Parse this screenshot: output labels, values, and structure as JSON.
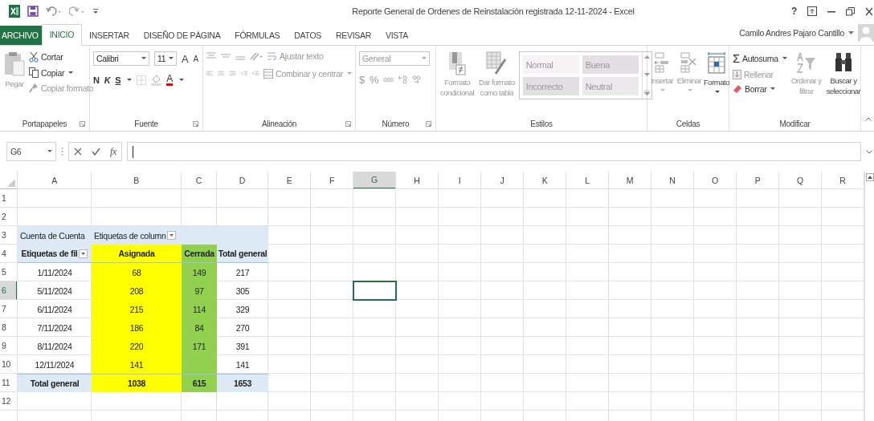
{
  "title_bar": {
    "title": "Reporte General de Ordenes de Reinstalación registrada 12-11-2024 - Excel",
    "help": "?"
  },
  "tabs": [
    {
      "label": "ARCHIVO",
      "kind": "file",
      "selected": false
    },
    {
      "label": "INICIO",
      "kind": "tab",
      "selected": true
    },
    {
      "label": "INSERTAR",
      "kind": "tab",
      "selected": false
    },
    {
      "label": "DISEÑO DE PÁGINA",
      "kind": "tab",
      "selected": false
    },
    {
      "label": "FÓRMULAS",
      "kind": "tab",
      "selected": false
    },
    {
      "label": "DATOS",
      "kind": "tab",
      "selected": false
    },
    {
      "label": "REVISAR",
      "kind": "tab",
      "selected": false
    },
    {
      "label": "VISTA",
      "kind": "tab",
      "selected": false
    }
  ],
  "account": {
    "user": "Camilo Andres Pajaro Cantillo"
  },
  "ribbon": {
    "clipboard": {
      "label": "Portapapeles",
      "paste": {
        "label": "Pegar",
        "disabled": true
      },
      "cut": {
        "label": "Cortar",
        "disabled": false
      },
      "copy": {
        "label": "Copiar",
        "disabled": false
      },
      "format_painter": {
        "label": "Copiar formato",
        "disabled": true
      }
    },
    "font": {
      "label": "Fuente",
      "font_name": "Calibri",
      "font_size": "11",
      "grow": "A",
      "shrink": "A",
      "bold": "N",
      "italic": "K",
      "underline": "S",
      "font_color": "A"
    },
    "alignment": {
      "label": "Alineación",
      "wrap_text": {
        "label": "Ajustar texto",
        "disabled": true
      },
      "merge": {
        "label": "Combinar y centrar",
        "disabled": true
      }
    },
    "number": {
      "label": "Número",
      "format": "General",
      "currency": "$",
      "percent": "%",
      "thousands": "000"
    },
    "styles": {
      "label": "Estilos",
      "conditional": {
        "lines": [
          "Formato",
          "condicional"
        ],
        "disabled": true
      },
      "as_table": {
        "lines": [
          "Dar formato",
          "como tabla"
        ],
        "disabled": true
      },
      "cell_styles": [
        {
          "label": "Normal",
          "kind": "normal"
        },
        {
          "label": "Buena",
          "kind": "good"
        },
        {
          "label": "Incorrecto",
          "kind": "bad"
        },
        {
          "label": "Neutral",
          "kind": "neutral"
        }
      ]
    },
    "cells": {
      "label": "Celdas",
      "items": [
        {
          "label": "Insertar",
          "disabled": true
        },
        {
          "label": "Eliminar",
          "disabled": true
        },
        {
          "label": "Formato",
          "disabled": false
        }
      ]
    },
    "editing": {
      "label": "Modificar",
      "autosum_symbol": "Σ",
      "autosum": {
        "label": "Autosuma",
        "disabled": false
      },
      "fill": {
        "label": "Rellenar",
        "disabled": true
      },
      "clear": {
        "label": "Borrar",
        "disabled": false
      },
      "sort": {
        "lines": [
          "Ordenar y",
          "filtrar"
        ],
        "disabled": true
      },
      "find": {
        "lines": [
          "Buscar y",
          "seleccionar"
        ],
        "disabled": false
      }
    }
  },
  "formula_bar": {
    "name_box": "G6",
    "function_button": "fx"
  },
  "sheet": {
    "columns": [
      {
        "label": "A",
        "selected": false
      },
      {
        "label": "B",
        "selected": false
      },
      {
        "label": "C",
        "selected": false
      },
      {
        "label": "D",
        "selected": false
      },
      {
        "label": "E",
        "selected": false
      },
      {
        "label": "F",
        "selected": false
      },
      {
        "label": "G",
        "selected": true
      },
      {
        "label": "H",
        "selected": false
      },
      {
        "label": "I",
        "selected": false
      },
      {
        "label": "J",
        "selected": false
      },
      {
        "label": "K",
        "selected": false
      },
      {
        "label": "L",
        "selected": false
      },
      {
        "label": "M",
        "selected": false
      },
      {
        "label": "N",
        "selected": false
      },
      {
        "label": "O",
        "selected": false
      },
      {
        "label": "P",
        "selected": false
      },
      {
        "label": "Q",
        "selected": false
      },
      {
        "label": "R",
        "selected": false
      }
    ],
    "rows": [
      {
        "label": "1",
        "selected": false
      },
      {
        "label": "2",
        "selected": false
      },
      {
        "label": "3",
        "selected": false
      },
      {
        "label": "4",
        "selected": false
      },
      {
        "label": "5",
        "selected": false
      },
      {
        "label": "6",
        "selected": true
      },
      {
        "label": "7",
        "selected": false
      },
      {
        "label": "8",
        "selected": false
      },
      {
        "label": "9",
        "selected": false
      },
      {
        "label": "10",
        "selected": false
      },
      {
        "label": "11",
        "selected": false
      },
      {
        "label": "12",
        "selected": false
      }
    ]
  },
  "pivot": {
    "value_label": "Cuenta de Cuenta",
    "column_labels": "Etiquetas de column",
    "row_labels": "Etiquetas de fil",
    "columns": [
      {
        "label": "Asignada",
        "color": "#ffff00"
      },
      {
        "label": "Cerrada",
        "color": "#92d050"
      },
      {
        "label": "Total general"
      }
    ],
    "rows": [
      {
        "label": "1/11/2024",
        "asignada": "68",
        "cerrada": "149",
        "total": "217"
      },
      {
        "label": "5/11/2024",
        "asignada": "208",
        "cerrada": "97",
        "total": "305"
      },
      {
        "label": "6/11/2024",
        "asignada": "215",
        "cerrada": "114",
        "total": "329"
      },
      {
        "label": "7/11/2024",
        "asignada": "186",
        "cerrada": "84",
        "total": "270"
      },
      {
        "label": "8/11/2024",
        "asignada": "220",
        "cerrada": "171",
        "total": "391"
      },
      {
        "label": "12/11/2024",
        "asignada": "141",
        "total": "141"
      }
    ],
    "total": {
      "label": "Total general",
      "asignada": "1038",
      "cerrada": "615",
      "total": "1653"
    }
  }
}
